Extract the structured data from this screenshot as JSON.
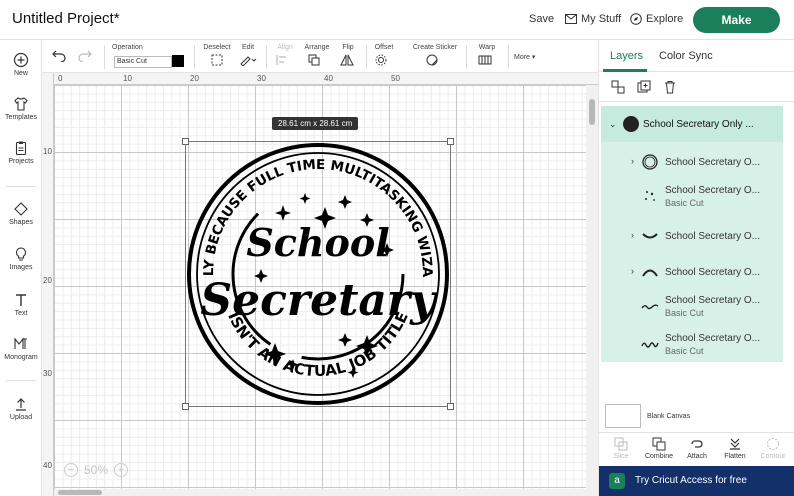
{
  "header": {
    "title": "Untitled Project*",
    "save": "Save",
    "my_stuff": "My Stuff",
    "explore": "Explore",
    "make": "Make"
  },
  "sidebar": {
    "items": [
      {
        "label": "New",
        "icon": "plus-circle-icon"
      },
      {
        "label": "Templates",
        "icon": "shirt-icon"
      },
      {
        "label": "Projects",
        "icon": "clipboard-icon"
      },
      {
        "label": "Shapes",
        "icon": "shapes-icon"
      },
      {
        "label": "Images",
        "icon": "lightbulb-icon"
      },
      {
        "label": "Text",
        "icon": "text-icon"
      },
      {
        "label": "Monogram",
        "icon": "monogram-icon"
      },
      {
        "label": "Upload",
        "icon": "upload-icon"
      }
    ]
  },
  "toolbar": {
    "operation_label": "Operation",
    "operation_value": "Basic Cut",
    "deselect": "Deselect",
    "edit": "Edit",
    "align": "Align",
    "arrange": "Arrange",
    "flip": "Flip",
    "offset": "Offset",
    "create_sticker": "Create Sticker",
    "warp": "Warp",
    "more": "More",
    "swatch_color": "#000000"
  },
  "canvas": {
    "ruler_top": [
      "0",
      "10",
      "20",
      "30",
      "40",
      "50"
    ],
    "ruler_left": [
      "10",
      "20",
      "30",
      "40"
    ],
    "dimensions": "28.61 cm x 28.61 cm",
    "zoom": "50%",
    "design": {
      "top_arc": "ONLY BECAUSE FULL TIME MULTITASKING WIZARD",
      "line1": "School",
      "line2": "Secretary",
      "bottom_arc": "ISN'T AN ACTUAL JOB TITLE"
    }
  },
  "panel": {
    "tabs": [
      "Layers",
      "Color Sync"
    ],
    "group_name": "School Secretary Only ...",
    "layers": [
      {
        "name": "School Secretary O...",
        "sub": ""
      },
      {
        "name": "School Secretary O...",
        "sub": "Basic Cut"
      },
      {
        "name": "School Secretary O...",
        "sub": ""
      },
      {
        "name": "School Secretary O...",
        "sub": ""
      },
      {
        "name": "School Secretary O...",
        "sub": "Basic Cut"
      },
      {
        "name": "School Secretary O...",
        "sub": "Basic Cut"
      }
    ],
    "blank_canvas": "Blank Canvas",
    "actions": [
      "Slice",
      "Combine",
      "Attach",
      "Flatten",
      "Contour"
    ],
    "access": "Try Cricut Access for free"
  }
}
